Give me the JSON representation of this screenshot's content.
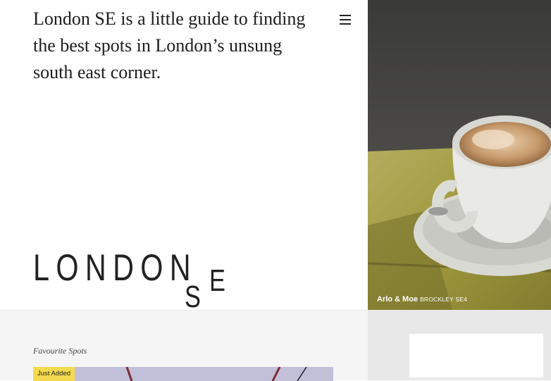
{
  "hero": {
    "tagline": "London SE is a little guide to finding the best spots in London’s unsung south east corner."
  },
  "logo": {
    "word": "LONDON",
    "s": "S",
    "e": "E"
  },
  "menu": {
    "icon": "hamburger-menu-icon"
  },
  "photo_caption": {
    "name": "Arlo & Moe",
    "area": "BROCKLEY SE4"
  },
  "favourites": {
    "label": "Favourite Spots",
    "badge": "Just Added"
  },
  "colors": {
    "badge": "#f3d94e",
    "lower_bg": "#f5f5f5",
    "text": "#1c1c1c"
  }
}
